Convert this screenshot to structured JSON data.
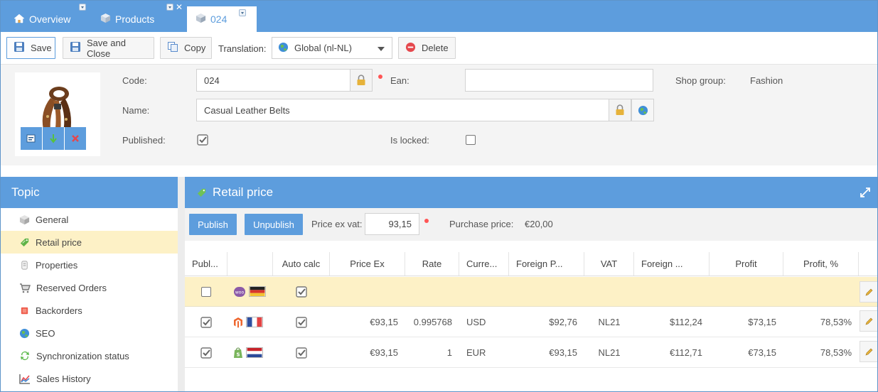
{
  "tabs": [
    {
      "label": "Overview",
      "icon": "home-icon"
    },
    {
      "label": "Products",
      "icon": "cube-icon"
    },
    {
      "label": "024",
      "icon": "cube-icon",
      "active": true
    }
  ],
  "toolbar": {
    "save": "Save",
    "save_close": "Save and Close",
    "copy": "Copy",
    "translation_label": "Translation:",
    "translation_value": "Global (nl-NL)",
    "delete": "Delete"
  },
  "product": {
    "code_label": "Code:",
    "code_value": "024",
    "ean_label": "Ean:",
    "ean_value": "",
    "shop_group_label": "Shop group:",
    "shop_group_value": "Fashion",
    "name_label": "Name:",
    "name_value": "Casual Leather Belts",
    "published_label": "Published:",
    "published": true,
    "locked_label": "Is locked:",
    "locked": false
  },
  "topic": {
    "title": "Topic",
    "items": [
      {
        "label": "General",
        "icon": "cube-icon"
      },
      {
        "label": "Retail price",
        "icon": "price-tag-icon",
        "selected": true
      },
      {
        "label": "Properties",
        "icon": "properties-icon"
      },
      {
        "label": "Reserved Orders",
        "icon": "cart-icon"
      },
      {
        "label": "Backorders",
        "icon": "backorder-icon"
      },
      {
        "label": "SEO",
        "icon": "globe-icon"
      },
      {
        "label": "Synchronization status",
        "icon": "sync-icon"
      },
      {
        "label": "Sales History",
        "icon": "chart-icon"
      }
    ]
  },
  "retail": {
    "title": "Retail price",
    "publish": "Publish",
    "unpublish": "Unpublish",
    "price_ex_label": "Price ex vat:",
    "price_ex_value": "93,15",
    "purchase_label": "Purchase price:",
    "purchase_value": "€20,00",
    "columns": [
      "Publ...",
      "",
      "Auto calc",
      "Price Ex",
      "Rate",
      "Curre...",
      "Foreign P...",
      "VAT",
      "Foreign ...",
      "Profit",
      "Profit, %"
    ],
    "rows": [
      {
        "published": false,
        "shop": "woocommerce-icon",
        "flag": "flag-de-icon",
        "auto": true,
        "price_ex": "",
        "rate": "",
        "currency": "",
        "foreign_price": "",
        "vat": "",
        "foreign_incl": "",
        "profit": "",
        "profit_pct": ""
      },
      {
        "published": true,
        "shop": "magento-icon",
        "flag": "flag-fr-icon",
        "auto": true,
        "price_ex": "€93,15",
        "rate": "0.995768",
        "currency": "USD",
        "foreign_price": "$92,76",
        "vat": "NL21",
        "foreign_incl": "$112,24",
        "profit": "$73,15",
        "profit_pct": "78,53%"
      },
      {
        "published": true,
        "shop": "shopify-icon",
        "flag": "flag-nl-icon",
        "auto": true,
        "price_ex": "€93,15",
        "rate": "1",
        "currency": "EUR",
        "foreign_price": "€93,15",
        "vat": "NL21",
        "foreign_incl": "€112,71",
        "profit": "€73,15",
        "profit_pct": "78,53%"
      }
    ]
  },
  "colors": {
    "accent": "#5d9ddd",
    "selected": "#fdf1c6",
    "delete": "#e5484d"
  }
}
